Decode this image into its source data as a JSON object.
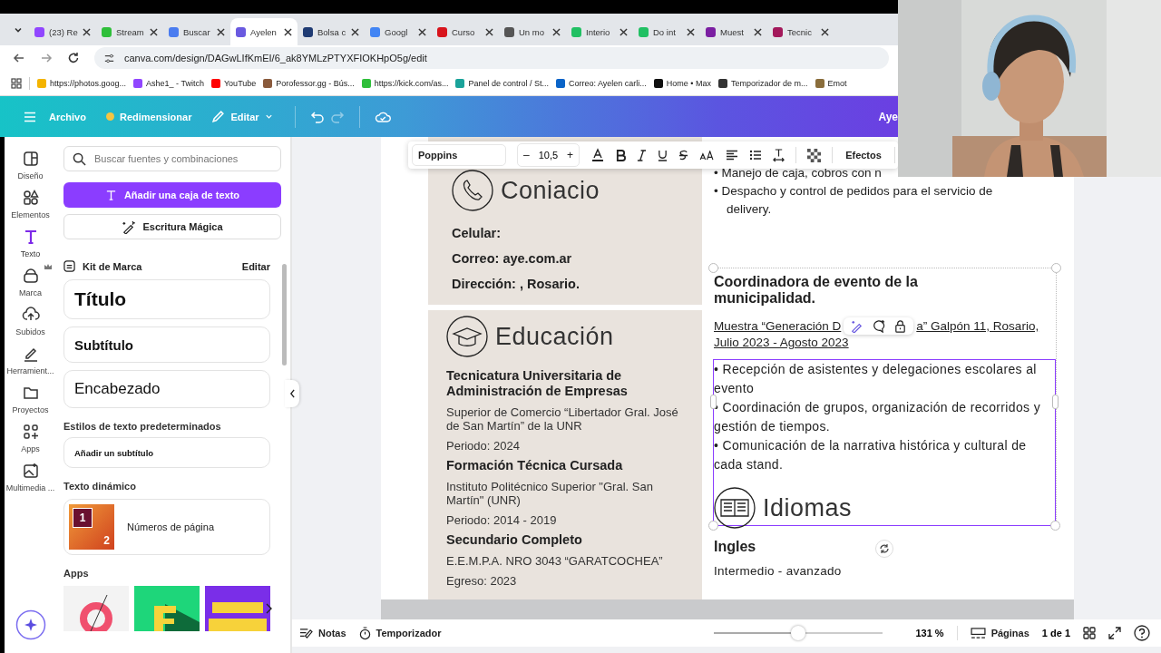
{
  "browser": {
    "tabs": [
      {
        "title": "(23) Re",
        "color": "#9146ff",
        "selected": false
      },
      {
        "title": "Stream",
        "color": "#2fbf3a",
        "selected": false
      },
      {
        "title": "Buscar",
        "color": "#4a7cf0",
        "selected": false
      },
      {
        "title": "Ayelen",
        "color": "#6a5ae0",
        "selected": true
      },
      {
        "title": "Bolsa c",
        "color": "#1f3b73",
        "selected": false
      },
      {
        "title": "Googl",
        "color": "#4285f4",
        "selected": false
      },
      {
        "title": "Curso",
        "color": "#d8141c",
        "selected": false
      },
      {
        "title": "Un mo",
        "color": "#555555",
        "selected": false
      },
      {
        "title": "Interio",
        "color": "#21c063",
        "selected": false
      },
      {
        "title": "Do int",
        "color": "#21c063",
        "selected": false
      },
      {
        "title": "Muest",
        "color": "#7b1fa2",
        "selected": false
      },
      {
        "title": "Tecnic",
        "color": "#a3195b",
        "selected": false
      }
    ],
    "url": "canva.com/design/DAGwLIfKmEI/6_ak8YMLzPTYXFIOKHpO5g/edit",
    "bookmarks": [
      {
        "label": "https://photos.goog...",
        "color": "#f4b400"
      },
      {
        "label": "Ashe1_ - Twitch",
        "color": "#9146ff"
      },
      {
        "label": "YouTube",
        "color": "#ff0000"
      },
      {
        "label": "Porofessor.gg - Bús...",
        "color": "#8a5a3c"
      },
      {
        "label": "https://kick.com/as...",
        "color": "#2fbf3a"
      },
      {
        "label": "Panel de control / St...",
        "color": "#1aa39a"
      },
      {
        "label": "Correo: Ayelen carli...",
        "color": "#0a64c8"
      },
      {
        "label": "Home • Max",
        "color": "#111111"
      },
      {
        "label": "Temporizador de m...",
        "color": "#333333"
      },
      {
        "label": "Emot",
        "color": "#8a6d3b"
      }
    ]
  },
  "editor_bar": {
    "file": "Archivo",
    "resize": "Redimensionar",
    "edit": "Editar",
    "redo_disabled": true,
    "user": "Aye"
  },
  "rail": [
    {
      "label": "Diseño",
      "kind": "layout",
      "selected": false
    },
    {
      "label": "Elementos",
      "kind": "shapes",
      "selected": false
    },
    {
      "label": "Texto",
      "kind": "text",
      "selected": true
    },
    {
      "label": "Marca",
      "kind": "brand",
      "selected": false
    },
    {
      "label": "Subidos",
      "kind": "upload",
      "selected": false
    },
    {
      "label": "Herramient...",
      "kind": "tools",
      "selected": false
    },
    {
      "label": "Proyectos",
      "kind": "folder",
      "selected": false
    },
    {
      "label": "Apps",
      "kind": "apps",
      "selected": false
    },
    {
      "label": "Multimedia ...",
      "kind": "media",
      "selected": false
    }
  ],
  "panel": {
    "search": {
      "placeholder": "Buscar fuentes y combinaciones"
    },
    "add_text": "Añadir una caja de texto",
    "magic_write": "Escritura Mágica",
    "brand_kit": {
      "title": "Kit de Marca",
      "edit": "Editar"
    },
    "styles": [
      {
        "label": "Título",
        "kind": "title"
      },
      {
        "label": "Subtítulo",
        "kind": "subtitle"
      },
      {
        "label": "Encabezado",
        "kind": "heading"
      }
    ],
    "default_title": "Estilos de texto predeterminados",
    "default_item": "Añadir un subtítulo",
    "dynamic_title": "Texto dinámico",
    "dynamic_item": {
      "label": "Números de página",
      "thumb_labels": [
        "1",
        "2"
      ]
    },
    "apps_title": "Apps",
    "apps": [
      {
        "kind": "g"
      },
      {
        "kind": "e"
      },
      {
        "kind": "type"
      }
    ]
  },
  "text_toolbar": {
    "font": "Poppins",
    "minus": "–",
    "size": "10,5",
    "plus": "+",
    "effects": "Efectos"
  },
  "document": {
    "contact": {
      "title": "Coniacio",
      "lines": [
        "Celular:",
        "Correo: aye.com.ar",
        "Dirección: , Rosario."
      ]
    },
    "education": {
      "title": "Educación",
      "entries": [
        {
          "heading": "Tecnicatura Universitaria de Administración de Empresas",
          "lines": [
            "Superior de Comercio “Libertador Gral. José de San Martín” de la UNR",
            "Periodo: 2024"
          ]
        },
        {
          "heading": "Formación Técnica Cursada",
          "lines": [
            "Instituto Politécnico Superior \"Gral. San Martín\" (UNR)",
            "Periodo: 2014 - 2019"
          ]
        },
        {
          "heading": "Secundario Completo",
          "lines": [
            "E.E.M.P.A. NRO 3043 “GARATCOCHEA”",
            "Egreso: 2023"
          ]
        }
      ]
    },
    "top_bullets": [
      "•  Manejo de caja, cobros con n",
      "•  Despacho y control de pedidos para el servicio de delivery."
    ],
    "job": {
      "title": "Coordinadora de evento de la municipalidad.",
      "place_start": "Muestra “Generación D",
      "place_end": "a” Galpón 11, Rosario,",
      "dates": "Julio 2023 - Agosto 2023",
      "bullets": [
        "• Recepción de asistentes y delegaciones escolares al evento",
        "• Coordinación de grupos, organización de recorridos y gestión de tiempos.",
        "• Comunicación de la narrativa histórica y cultural de cada stand."
      ]
    },
    "languages": {
      "title": "Idiomas",
      "name": "Ingles",
      "level": "Intermedio - avanzado"
    }
  },
  "bottom_bar": {
    "notes": "Notas",
    "timer": "Temporizador",
    "zoom": {
      "level": 0.5
    },
    "zoom_reading": "131 %",
    "pages": "Páginas",
    "page_count": "1 de 1"
  }
}
